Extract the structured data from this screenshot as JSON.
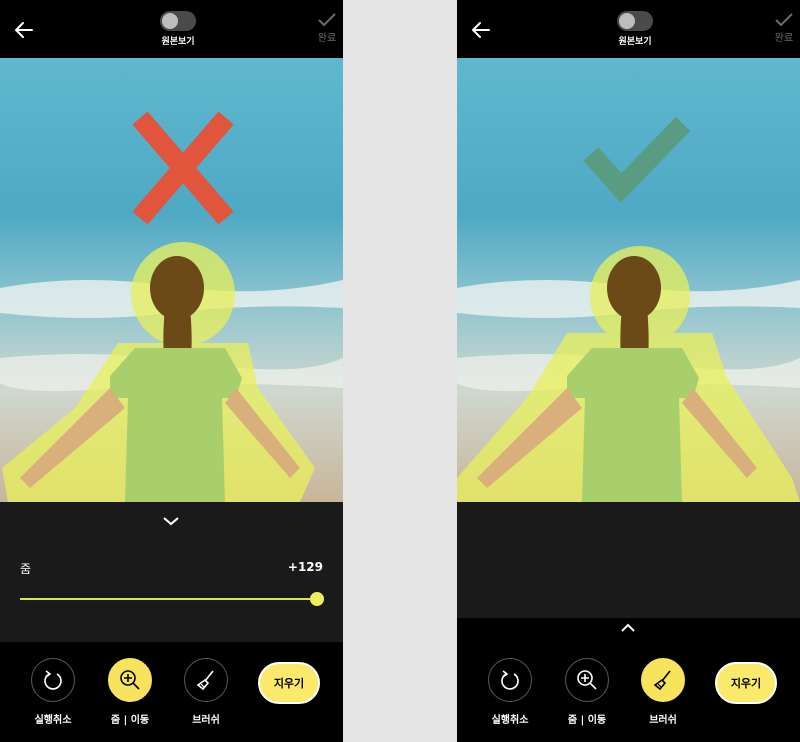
{
  "colors": {
    "accent_yellow": "#f7e35c",
    "slider_yellow": "#d8e84a",
    "wrong_mark": "#e0553b",
    "correct_mark": "#5a9c81",
    "mask_overlay": "#e8f05a"
  },
  "screens": [
    {
      "header": {
        "toggle_label": "원본보기",
        "done_label": "완료"
      },
      "result_mark": "x-mark-icon",
      "zoom_panel": {
        "label": "줌",
        "value": "+129",
        "slider_level_fraction": 1.0
      },
      "toolbar": {
        "tools": [
          {
            "label": "실행취소",
            "icon": "undo-icon",
            "active": false
          },
          {
            "label": "줌 | 이동",
            "icon": "zoom-in-icon",
            "active": true
          },
          {
            "label": "브러쉬",
            "icon": "brush-icon",
            "active": false
          }
        ],
        "erase_label": "지우기"
      }
    },
    {
      "header": {
        "toggle_label": "원본보기",
        "done_label": "완료"
      },
      "result_mark": "check-mark-icon",
      "toolbar": {
        "tools": [
          {
            "label": "실행취소",
            "icon": "undo-icon",
            "active": false
          },
          {
            "label": "줌 | 이동",
            "icon": "zoom-in-icon",
            "active": false
          },
          {
            "label": "브러쉬",
            "icon": "brush-icon",
            "active": true
          }
        ],
        "erase_label": "지우기"
      }
    }
  ]
}
